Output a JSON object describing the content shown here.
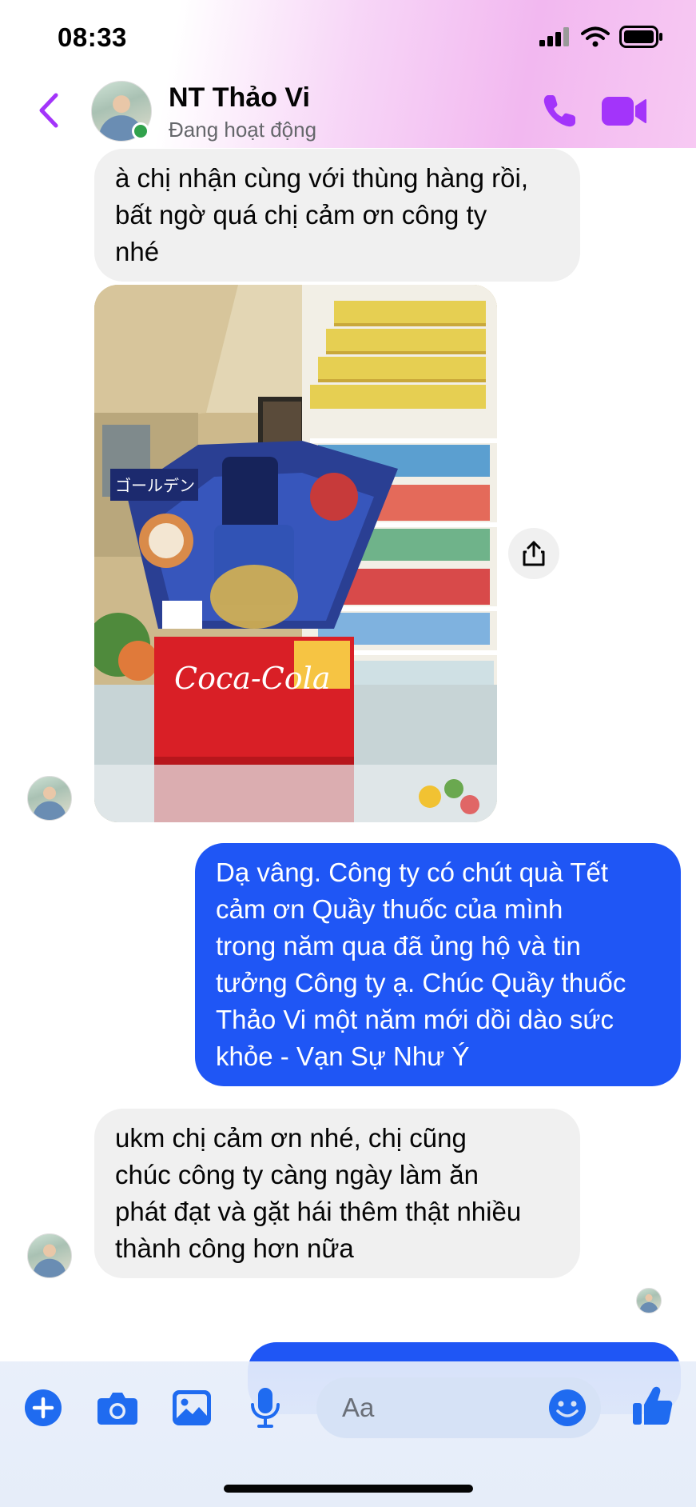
{
  "status_bar": {
    "time": "08:33"
  },
  "header": {
    "contact_name": "NT Thảo Vi",
    "contact_status": "Đang hoạt động",
    "icons": [
      "back-chevron-icon",
      "phone-icon",
      "video-camera-icon"
    ],
    "accent_color": "#a334fa"
  },
  "messages": [
    {
      "direction": "incoming",
      "type": "text",
      "lines": [
        "à chị nhận cùng với thùng hàng rồi,",
        "bất ngờ quá chị cảm ơn công ty",
        "nhé"
      ]
    },
    {
      "direction": "incoming",
      "type": "photo",
      "photo_texts": [
        "Coca-Cola",
        "ゴールデン"
      ]
    },
    {
      "direction": "outgoing",
      "type": "text",
      "lines": [
        "Dạ vâng. Công ty có chút quà Tết",
        "cảm ơn Quầy thuốc của mình",
        "trong năm qua đã ủng hộ và tin",
        "tưởng Công ty ạ. Chúc Quầy thuốc",
        "Thảo Vi một năm mới dồi dào sức",
        "khỏe - Vạn Sự Như Ý"
      ]
    },
    {
      "direction": "incoming",
      "type": "text",
      "lines": [
        "ukm chị cảm ơn nhé, chị cũng",
        "chúc công ty càng ngày làm ăn",
        "phát đạt và gặt hái thêm thật nhiều",
        "thành công hơn nữa"
      ]
    }
  ],
  "composer": {
    "placeholder": "Aa",
    "buttons": [
      "plus-circle-icon",
      "camera-icon",
      "photo-gallery-icon",
      "microphone-icon",
      "emoji-icon",
      "thumbs-up-icon"
    ],
    "accent_color": "#1f6bf0"
  },
  "colors": {
    "incoming_bubble": "#f0f0f0",
    "outgoing_bubble": "#1f56f5",
    "online_dot": "#31a24c"
  }
}
